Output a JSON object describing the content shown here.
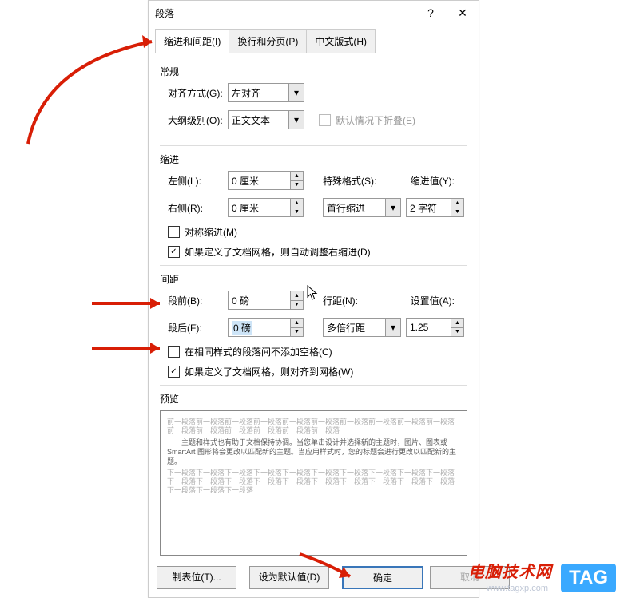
{
  "titlebar": {
    "title": "段落",
    "help": "?",
    "close": "✕"
  },
  "tabs": {
    "t1": "缩进和间距(I)",
    "t2": "换行和分页(P)",
    "t3": "中文版式(H)"
  },
  "general": {
    "heading": "常规",
    "alignment_label": "对齐方式(G):",
    "alignment_value": "左对齐",
    "outline_label": "大纲级别(O):",
    "outline_value": "正文文本",
    "collapsed_label": "默认情况下折叠(E)"
  },
  "indent": {
    "heading": "缩进",
    "left_label": "左侧(L):",
    "left_value": "0 厘米",
    "right_label": "右侧(R):",
    "right_value": "0 厘米",
    "special_label": "特殊格式(S):",
    "special_value": "首行缩进",
    "by_label": "缩进值(Y):",
    "by_value": "2 字符",
    "mirror_label": "对称缩进(M)",
    "autoadjust_label": "如果定义了文档网格，则自动调整右缩进(D)"
  },
  "spacing": {
    "heading": "间距",
    "before_label": "段前(B):",
    "before_value": "0 磅",
    "after_label": "段后(F):",
    "after_value": "0 磅",
    "linespacing_label": "行距(N):",
    "linespacing_value": "多倍行距",
    "at_label": "设置值(A):",
    "at_value": "1.25",
    "noextra_label": "在相同样式的段落间不添加空格(C)",
    "snapgrid_label": "如果定义了文档网格，则对齐到网格(W)"
  },
  "preview": {
    "heading": "预览",
    "before": "前一段落前一段落前一段落前一段落前一段落前一段落前一段落前一段落前一段落前一段落前一段落前一段落前一段落前一段落前一段落前一段落",
    "body": "　　主题和样式也有助于文档保持协调。当您单击设计并选择新的主题时，图片、图表或 SmartArt 图形将会更改以匹配新的主题。当应用样式时，您的标题会进行更改以匹配新的主题。",
    "after": "下一段落下一段落下一段落下一段落下一段落下一段落下一段落下一段落下一段落下一段落下一段落下一段落下一段落下一段落下一段落下一段落下一段落下一段落下一段落下一段落下一段落下一段落下一段落"
  },
  "buttons": {
    "tabs": "制表位(T)...",
    "default": "设为默认值(D)",
    "ok": "确定",
    "cancel": "取消"
  },
  "overlay": {
    "brand": "电脑技术网",
    "tag": "TAG"
  }
}
